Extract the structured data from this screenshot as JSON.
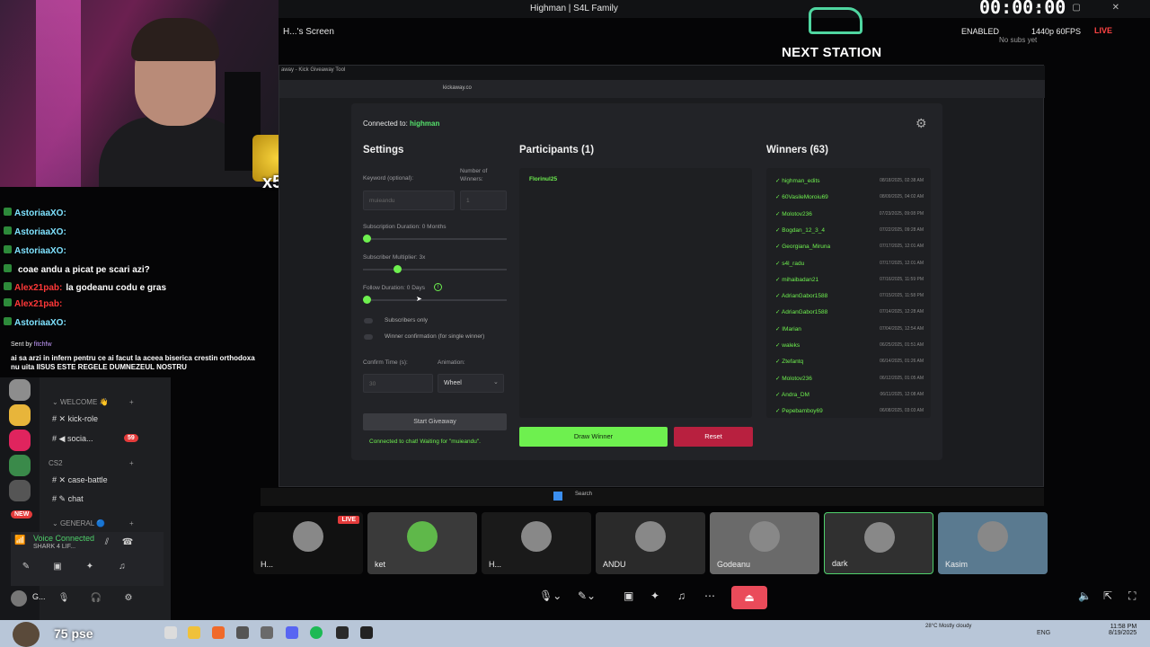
{
  "window_title": "Highman | S4L Family",
  "timer": "00:00:00",
  "screen_name": "H...'s Screen",
  "next_station": "NEXT STATION",
  "status": {
    "enabled": "ENABLED",
    "quality": "1440p 60FPS",
    "live": "LIVE",
    "no_subs": "No subs yet"
  },
  "browser": {
    "tab": "away - Kick Giveaway Tool",
    "url": "kickaway.co"
  },
  "giveaway": {
    "connected_prefix": "Connected to:",
    "connected_channel": "highman",
    "settings": {
      "title": "Settings",
      "keyword_label": "Keyword (optional):",
      "keyword_value": "muieandu",
      "winners_label": "Number of Winners:",
      "winners_value": "1",
      "sub_duration_label": "Subscription Duration: 0 Months",
      "sub_multiplier_label": "Subscriber Multiplier: 3x",
      "follow_duration_label": "Follow Duration:  0  Days",
      "toggle_subs_only": "Subscribers only",
      "toggle_confirmation": "Winner confirmation (for single winner)",
      "confirm_time_label": "Confirm Time (s):",
      "confirm_time_value": "30",
      "animation_label": "Animation:",
      "animation_value": "Wheel",
      "start_button": "Start Giveaway",
      "status_text": "Connected to chat! Waiting for \"muieandu\"."
    },
    "participants": {
      "title": "Participants (1)",
      "items": [
        "Florinul25"
      ]
    },
    "winners": {
      "title": "Winners (63)",
      "items": [
        {
          "name": "highman_edits",
          "date": "08/18/2025, 02:38 AM"
        },
        {
          "name": "60VasileMoroiu69",
          "date": "08/09/2025, 04:02 AM"
        },
        {
          "name": "Molotov236",
          "date": "07/23/2025, 09:08 PM"
        },
        {
          "name": "Bogdan_12_3_4",
          "date": "07/22/2025, 09:28 AM"
        },
        {
          "name": "Georgiana_Miruna",
          "date": "07/17/2025, 12:01 AM"
        },
        {
          "name": "s4l_radu",
          "date": "07/17/2025, 12:01 AM"
        },
        {
          "name": "mihaibadan21",
          "date": "07/16/2025, 11:59 PM"
        },
        {
          "name": "AdrianGabor1588",
          "date": "07/15/2025, 11:58 PM"
        },
        {
          "name": "AdrianGabor1588",
          "date": "07/14/2025, 12:28 AM"
        },
        {
          "name": "IMarian",
          "date": "07/04/2025, 12:54 AM"
        },
        {
          "name": "waleks",
          "date": "06/25/2025, 01:51 AM"
        },
        {
          "name": "Ztefantq",
          "date": "06/14/2025, 01:26 AM"
        },
        {
          "name": "Molotov236",
          "date": "06/12/2025, 01:05 AM"
        },
        {
          "name": "Andra_DM",
          "date": "06/11/2025, 12:08 AM"
        },
        {
          "name": "Pepebamboy69",
          "date": "06/08/2025, 03:03 AM"
        }
      ]
    },
    "draw_button": "Draw Winner",
    "reset_button": "Reset"
  },
  "chat": {
    "lines": [
      {
        "user": "AstoriaaXO:",
        "msg": "",
        "cls": "u-astoria"
      },
      {
        "user": "AstoriaaXO:",
        "msg": "",
        "cls": "u-astoria"
      },
      {
        "user": "AstoriaaXO:",
        "msg": "",
        "cls": "u-astoria"
      },
      {
        "user": "",
        "msg": "coae andu a picat pe scari azi?",
        "cls": "u-alex"
      },
      {
        "user": "Alex21pab:",
        "msg": "la godeanu codu e gras",
        "cls": "u-alex"
      },
      {
        "user": "Alex21pab:",
        "msg": "",
        "cls": "u-alex"
      },
      {
        "user": "AstoriaaXO:",
        "msg": "",
        "cls": "u-astoria"
      }
    ],
    "sent_by": "Sent by",
    "sent_user": "fitchfw",
    "long_msg": "ai sa arzi in infern pentru ce ai facut la aceea biserica crestin orthodoxa nu uita IISUS ESTE REGELE DUMNEZEUL NOSTRU"
  },
  "discord": {
    "welcome": "WELCOME",
    "kick_role": "kick-role",
    "social": "socia...",
    "social_badge": "59",
    "cs2": "CS2",
    "case_battle": "case-battle",
    "chat": "chat",
    "general": "GENERAL",
    "new_badge": "NEW",
    "voice_title": "Voice Connected",
    "voice_sub": "SHARK 4 LIF...",
    "user_short": "G..."
  },
  "tiles": [
    {
      "name": "H...",
      "live": "LIVE"
    },
    {
      "name": "ket"
    },
    {
      "name": "H..."
    },
    {
      "name": "ANDU"
    },
    {
      "name": "Godeanu"
    },
    {
      "name": "dark"
    },
    {
      "name": "Kasim"
    }
  ],
  "taskbar": {
    "subs": "75 pse",
    "weather": "28°C Mostly cloudy",
    "lang": "ENG",
    "time": "11:58 PM",
    "date": "8/19/2025"
  },
  "inner_search": "Search",
  "colors": {
    "accent_green": "#6ef04f",
    "reset_red": "#b8203f",
    "live_red": "#e43b3b"
  }
}
